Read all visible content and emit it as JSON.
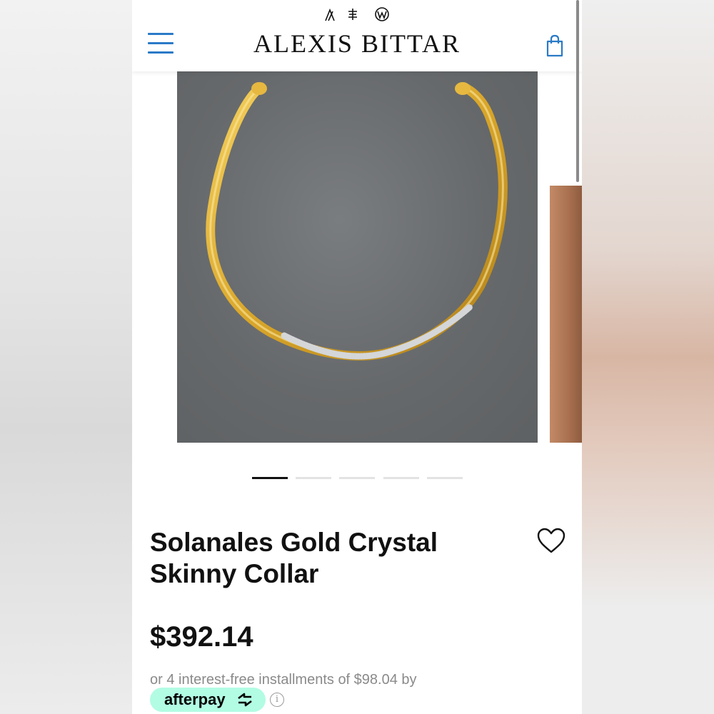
{
  "header": {
    "brand": "ALEXIS BITTAR",
    "menu_icon": "hamburger-menu-icon",
    "bag_icon": "shopping-bag-icon",
    "brand_marks_icon": "brand-symbols-icon"
  },
  "gallery": {
    "slide_count": 5,
    "active_slide": 1
  },
  "product": {
    "title_line1": "Solanales Gold Crystal",
    "title_line2": "Skinny Collar",
    "price": "$392.14",
    "installments_text": "or 4 interest-free installments of $98.04 by",
    "afterpay_label": "afterpay",
    "info_glyph": "i",
    "favorite_icon": "heart-icon"
  },
  "colors": {
    "accent_blue": "#2a7ac7",
    "afterpay_mint": "#b2fce4",
    "gold": "#d9a62a",
    "text": "#111111"
  }
}
